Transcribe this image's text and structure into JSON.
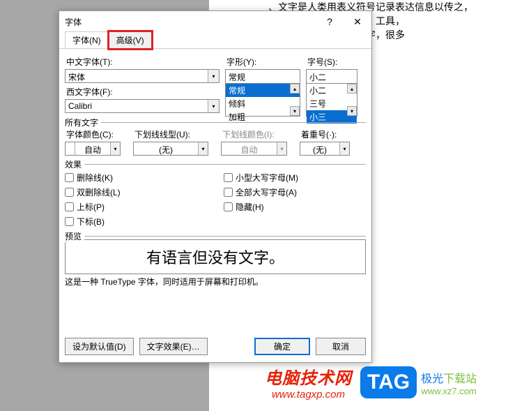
{
  "doc_bg": {
    "line1": "、文字是人类用表义符号记录表达信息以传之，",
    "line2": "代文字多是记录语言的，工具，",
    "line3": "语言后产生书面的，文字，很多"
  },
  "dialog": {
    "title": "字体",
    "help": "?",
    "close": "✕",
    "tabs": {
      "font": "字体(N)",
      "advanced": "高级(V)"
    },
    "labels": {
      "chinese_font": "中文字体(T):",
      "western_font": "西文字体(F):",
      "font_style": "字形(Y):",
      "font_size": "字号(S):",
      "all_text": "所有文字",
      "font_color": "字体颜色(C):",
      "underline_style": "下划线线型(U):",
      "underline_color": "下划线颜色(I):",
      "emphasis": "着重号(·):",
      "effects": "效果",
      "preview": "预览"
    },
    "chinese_font": "宋体",
    "western_font": "Calibri",
    "font_style_value": "常规",
    "font_style_list": [
      "常规",
      "倾斜",
      "加粗"
    ],
    "font_size_value": "小二",
    "font_size_list": [
      "小二",
      "三号",
      "小三"
    ],
    "font_color": "自动",
    "underline_style": "(无)",
    "underline_color": "自动",
    "emphasis": "(无)",
    "checkboxes": {
      "strikethrough": "删除线(K)",
      "double_strike": "双删除线(L)",
      "superscript": "上标(P)",
      "subscript": "下标(B)",
      "small_caps": "小型大写字母(M)",
      "all_caps": "全部大写字母(A)",
      "hidden": "隐藏(H)"
    },
    "preview_text": "有语言但没有文字。",
    "preview_note": "这是一种 TrueType 字体，同时适用于屏幕和打印机。",
    "buttons": {
      "set_default": "设为默认值(D)",
      "text_effects": "文字效果(E)…",
      "ok": "确定",
      "cancel": "取消"
    }
  },
  "watermark": {
    "left_title": "电脑技术网",
    "left_url": "www.tagxp.com",
    "tag": "TAG",
    "right_title_pre": "极光",
    "right_title_suf": "下载站",
    "right_url": "www.xz7.com"
  }
}
